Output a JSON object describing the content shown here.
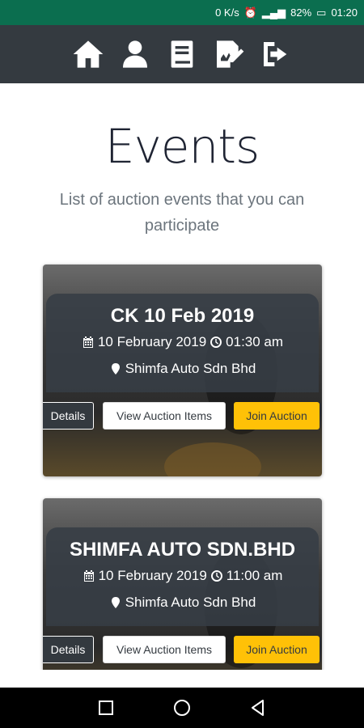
{
  "status_bar": {
    "network_speed": "0 K/s",
    "battery": "82%",
    "time": "01:20"
  },
  "navbar": {
    "icons": [
      "home-icon",
      "user-icon",
      "book-icon",
      "edit-document-icon",
      "sign-out-icon"
    ]
  },
  "page": {
    "title": "Events",
    "subtitle": "List of auction events that you can participate"
  },
  "events": [
    {
      "title": "CK 10 Feb 2019",
      "date": "10 February 2019",
      "time": "01:30 am",
      "location": "Shimfa Auto Sdn Bhd",
      "details_label": "Details",
      "view_label": "View Auction Items",
      "join_label": "Join Auction"
    },
    {
      "title": "SHIMFA AUTO SDN.BHD",
      "date": "10 February 2019",
      "time": "11:00 am",
      "location": "Shimfa Auto Sdn Bhd",
      "details_label": "Details",
      "view_label": "View Auction Items",
      "join_label": "Join Auction"
    }
  ],
  "colors": {
    "status_bar": "#0b6e4f",
    "navbar": "#343a40",
    "join_button": "#ffc107"
  }
}
